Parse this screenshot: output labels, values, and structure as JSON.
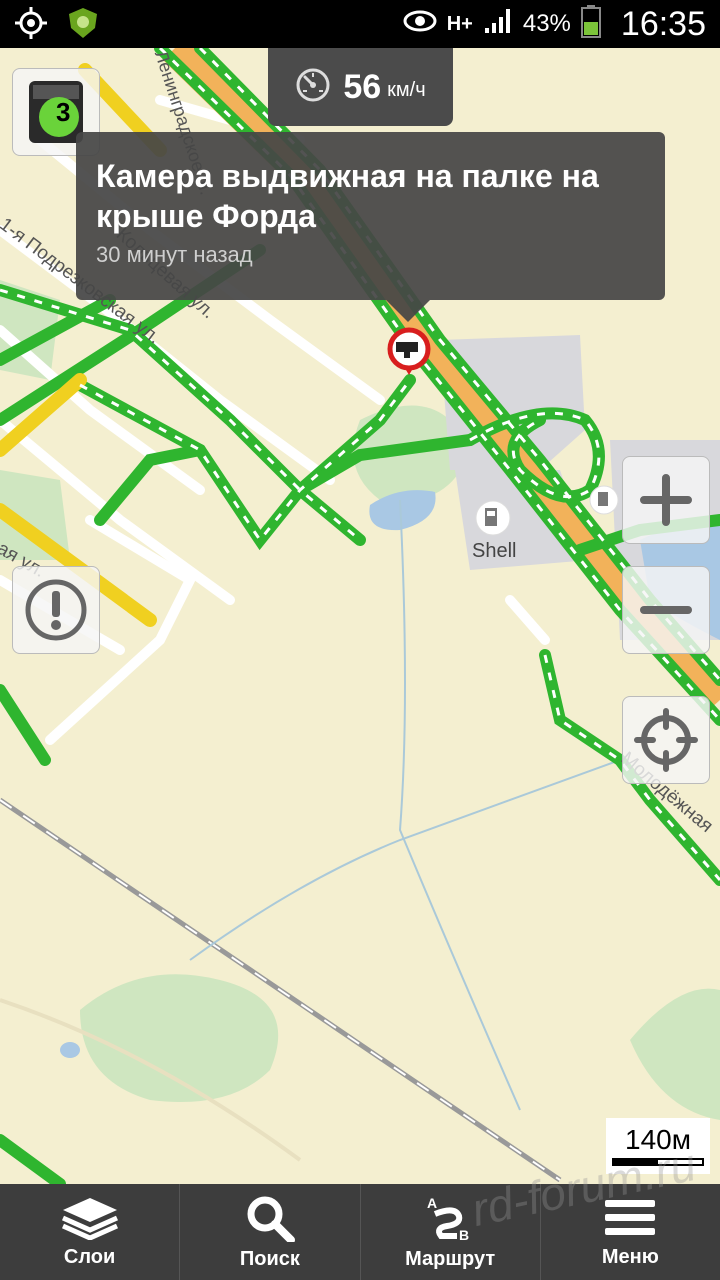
{
  "status_bar": {
    "network": "H+",
    "battery_pct": "43%",
    "time": "16:35"
  },
  "speed": {
    "value": "56",
    "unit": "км/ч"
  },
  "popup": {
    "title": "Камера выдвижная на палке на крыше Форда",
    "time": "30 минут назад"
  },
  "traffic_level": "3",
  "map": {
    "poi_shell": "Shell",
    "street_1": "1-я Подрезковская ул.",
    "street_2": "Кольцевая ул.",
    "street_3": "ая ул.",
    "street_4": "Ленинградское ш.",
    "street_5": "Молодёжная"
  },
  "scale": {
    "label": "140м"
  },
  "bottom_nav": [
    {
      "label": "Слои",
      "icon": "layers-icon"
    },
    {
      "label": "Поиск",
      "icon": "search-icon"
    },
    {
      "label": "Маршрут",
      "icon": "route-icon"
    },
    {
      "label": "Меню",
      "icon": "menu-icon"
    }
  ],
  "watermark": "rd-forum.ru",
  "colors": {
    "map_bg": "#f4efd0",
    "traffic_green": "#2fb52f",
    "traffic_yellow": "#f0d020",
    "camera_red": "#d81e1e",
    "bar_bg": "#3d3d3d"
  }
}
